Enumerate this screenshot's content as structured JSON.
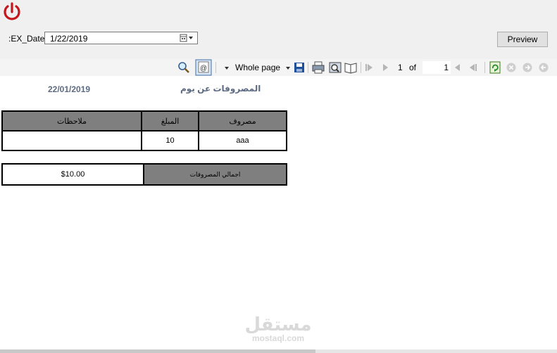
{
  "app": {
    "filter": {
      "label": ":EX_Date",
      "date_value": "1/22/2019"
    },
    "preview_label": "Preview"
  },
  "toolbar": {
    "zoom_label": "Whole page",
    "current_page": "1",
    "of_label": "of",
    "total_pages": "1",
    "icons": [
      "search-icon",
      "email-icon",
      "dropdown-icon",
      "save-icon",
      "print-icon",
      "print-preview-icon",
      "page-layout-icon",
      "first-page-icon",
      "previous-page-icon",
      "next-page-icon",
      "last-page-icon",
      "refresh-icon",
      "stop-icon",
      "forward-icon",
      "back-icon"
    ]
  },
  "report": {
    "date": "22/01/2019",
    "title": "المصروفات عن يوم",
    "table": {
      "headers": [
        "مصروف",
        "المبلغ",
        "ملاحظات"
      ],
      "rows": [
        {
          "expense": "aaa",
          "amount": "10",
          "notes": ""
        }
      ]
    },
    "total": {
      "label": "اجمالي المصروفات",
      "value": "$10.00"
    }
  },
  "watermark": {
    "arabic": "مستقل",
    "latin": "mostaql.com"
  }
}
